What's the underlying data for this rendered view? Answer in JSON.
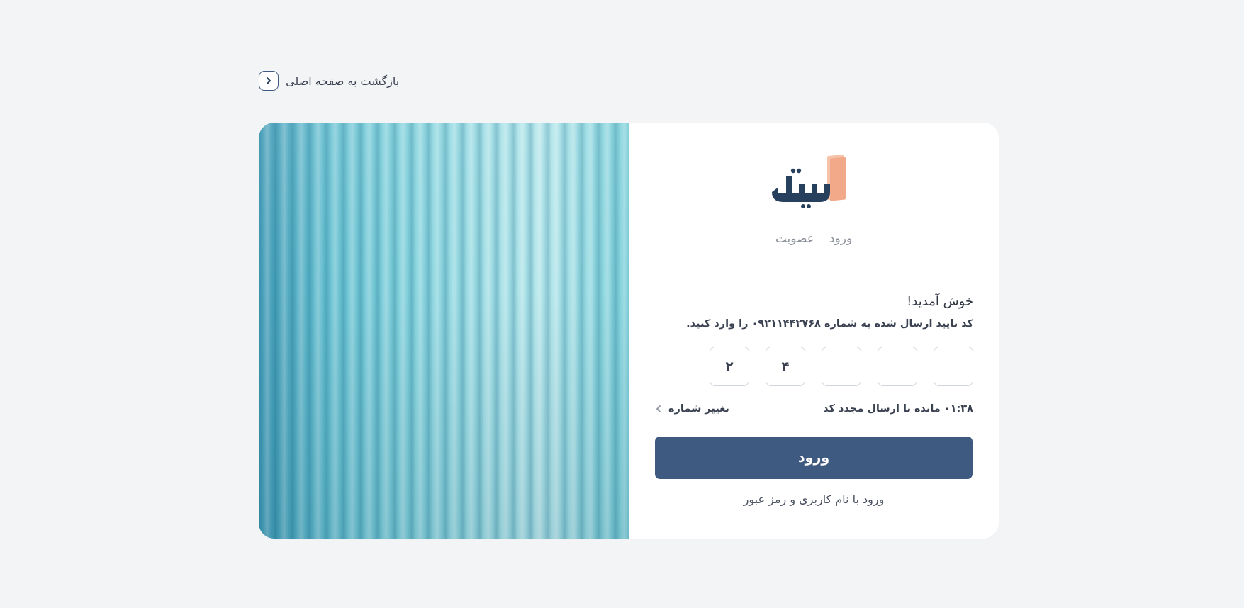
{
  "nav": {
    "back_label": "بازگشت به صفحه اصلی",
    "back_icon": "chevron-right-icon"
  },
  "brand": {
    "logo_text": "تلنتی",
    "text_color": "#26405e",
    "accent_color": "#f2a98a"
  },
  "auth_tabs": {
    "login_label": "ورود",
    "signup_label": "عضویت"
  },
  "form": {
    "welcome": "خوش آمدید!",
    "instruction": "کد تایید ارسال شده به شماره ۰۹۲۱۱۴۴۲۷۶۸ را وارد کنید.",
    "otp_digits": [
      "",
      "",
      "",
      "۴",
      "۲"
    ],
    "timer_text": "۰۱:۳۸ مانده تا ارسال مجدد کد",
    "change_number_label": "تغییر شماره",
    "submit_label": "ورود",
    "alt_login_label": "ورود با نام کاربری و رمز عبور"
  },
  "colors": {
    "primary": "#3f5a80",
    "background": "#f3f4f6",
    "card": "#ffffff"
  }
}
